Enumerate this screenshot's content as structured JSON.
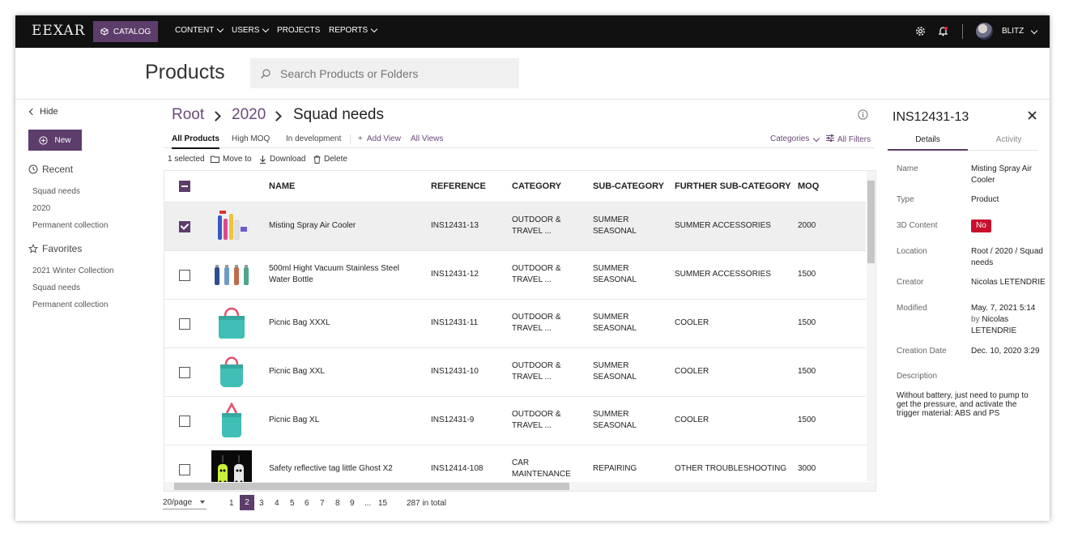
{
  "nav": {
    "logo": "EEXAR",
    "catalog": "CATALOG",
    "items": [
      "CONTENT",
      "USERS",
      "PROJECTS",
      "REPORTS"
    ],
    "username": "BLITZ"
  },
  "header": {
    "title": "Products",
    "search_placeholder": "Search Products or Folders"
  },
  "sidebar": {
    "hide": "Hide",
    "new": "New",
    "recent_title": "Recent",
    "recent": [
      "Squad needs",
      "2020",
      "Permanent collection"
    ],
    "favorites_title": "Favorites",
    "favorites": [
      "2021 Winter Collection",
      "Squad needs",
      "Permanent collection"
    ]
  },
  "breadcrumb": [
    "Root",
    "2020",
    "Squad needs"
  ],
  "views": {
    "tabs": [
      "All Products",
      "High MOQ",
      "In development"
    ],
    "add_view": "Add View",
    "all_views": "All Views",
    "categories": "Categories",
    "all_filters": "All Filters"
  },
  "actions": {
    "selected": "1 selected",
    "move": "Move to",
    "download": "Download",
    "delete": "Delete"
  },
  "table": {
    "columns": [
      "NAME",
      "REFERENCE",
      "CATEGORY",
      "SUB-CATEGORY",
      "FURTHER SUB-CATEGORY",
      "MOQ"
    ],
    "rows": [
      {
        "name": "Misting Spray Air Cooler",
        "ref": "INS12431-13",
        "cat1": "OUTDOOR &",
        "cat2": "TRAVEL ...",
        "sub1": "SUMMER",
        "sub2": "SEASONAL",
        "further": "SUMMER ACCESSORIES",
        "moq": "2000",
        "selected": true
      },
      {
        "name": "500ml Hight Vacuum Stainless Steel",
        "name2": "Water Bottle",
        "ref": "INS12431-12",
        "cat1": "OUTDOOR &",
        "cat2": "TRAVEL ...",
        "sub1": "SUMMER",
        "sub2": "SEASONAL",
        "further": "SUMMER ACCESSORIES",
        "moq": "1500"
      },
      {
        "name": "Picnic Bag XXXL",
        "ref": "INS12431-11",
        "cat1": "OUTDOOR &",
        "cat2": "TRAVEL ...",
        "sub1": "SUMMER",
        "sub2": "SEASONAL",
        "further": "COOLER",
        "moq": "1500"
      },
      {
        "name": "Picnic Bag XXL",
        "ref": "INS12431-10",
        "cat1": "OUTDOOR &",
        "cat2": "TRAVEL ...",
        "sub1": "SUMMER",
        "sub2": "SEASONAL",
        "further": "COOLER",
        "moq": "1500"
      },
      {
        "name": "Picnic Bag XL",
        "ref": "INS12431-9",
        "cat1": "OUTDOOR &",
        "cat2": "TRAVEL ...",
        "sub1": "SUMMER",
        "sub2": "SEASONAL",
        "further": "COOLER",
        "moq": "1500"
      },
      {
        "name": "Safety reflective tag little Ghost X2",
        "ref": "INS12414-108",
        "cat1": "CAR",
        "cat2": "MAINTENANCE",
        "sub1": "REPAIRING",
        "sub2": "",
        "further": "OTHER TROUBLESHOOTING",
        "moq": "3000"
      }
    ]
  },
  "pagination": {
    "per_page": "20/page",
    "pages": [
      "1",
      "2",
      "3",
      "4",
      "5",
      "6",
      "7",
      "8",
      "9",
      "...",
      "15"
    ],
    "current": "2",
    "total": "287 in total"
  },
  "details": {
    "title": "INS12431-13",
    "tabs": [
      "Details",
      "Activity"
    ],
    "name_label": "Name",
    "name_value": "Misting Spray Air Cooler",
    "type_label": "Type",
    "type_value": "Product",
    "content_label": "3D Content",
    "content_value": "No",
    "location_label": "Location",
    "location_value": "Root / 2020 / Squad needs",
    "creator_label": "Creator",
    "creator_value": "Nicolas LETENDRIE",
    "modified_label": "Modified",
    "modified_value": "May. 7, 2021 5:14",
    "modified_by": "by",
    "modified_by_name": "Nicolas LETENDRIE",
    "created_label": "Creation Date",
    "created_value": "Dec. 10, 2020 3:29",
    "desc_label": "Description",
    "desc_value": "Without battery, just need to pump to get the pressure, and activate the trigger      material: ABS and PS"
  },
  "colors": {
    "brand": "#5c3d6b",
    "nav_bg": "#111111",
    "badge": "#c8102e"
  }
}
